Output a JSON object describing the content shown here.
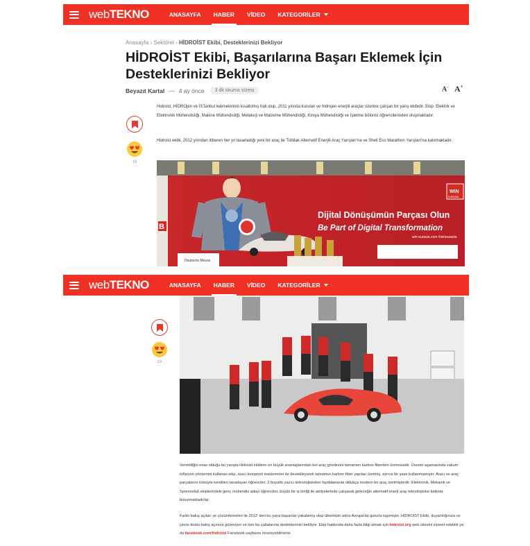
{
  "nav": {
    "logo_a": "web",
    "logo_b": "TEKNO",
    "items": [
      "ANASAYFA",
      "HABER",
      "VİDEO",
      "KATEGORİLER"
    ]
  },
  "breadcrumb": {
    "home": "Anasayfa",
    "sep": "›",
    "category": "Sektörel",
    "current": "HİDROİST Ekibi, Desteklerinizi Bekliyor"
  },
  "article": {
    "title": "HİDROİST Ekibi, Başarılarına Başarı Eklemek İçin Desteklerinizi Bekliyor",
    "author": "Beyazıt Kartal",
    "dash": "—",
    "time": "4 ay önce",
    "read_time": "3 dk okuma süresi",
    "font_small": "A",
    "font_large": "A",
    "reaction_count": "19",
    "paragraphs": [
      "Hidroist, HİDROjen ve İSTanbul kelimelerinin kısaltılmış hali olup, 2011 yılında kurulan ve hidrojen enerjili araçlar üzerine çalışan bir yarış ekibidir. Ekip; Elektrik ve Elektronik Mühendisliği, Makine Mühendisliği, Metalurji ve Malzeme Mühendisliği, Kimya Mühendisliği ve İşletme bölümü öğrencilerinden oluşmaktadır.",
      "Hidroist ekibi, 2012 yılından itibaren her yıl tasarladığı yeni bir araç ile Tübitak Alternatif Enerjili Araç Yarışları'na ve Shell Eco Marathon Yarışları'na katılmaktadır."
    ],
    "banner": {
      "line1": "Dijital Dönüşümün Parçası Olun",
      "line2": "Be Part of Digital Transformation",
      "badge": "WIN",
      "badge_sub": "EURASIA",
      "footer_left": "Deutsche Messe",
      "footer_right": "win-eurasia.com   #wineurasia",
      "left_letter": "B"
    },
    "paragraphs2": [
      "Verimliliğin esas olduğu bu yarışta Hidroist ekibinin en büyük avantajlarından biri araç gövdesini tamamen karbon fiberden üretmesidir. Üresim aşamasında vakum infüzyon yöntemini kullanan ekip, aracı kompozit malzemeler ile destekleyerek tamamen karbon fiber yapılan üretmiş, ayrıca bir şase kullanmamıştır. Aracı ve araç parçalarını tümüyle kendileri tasarlayan öğrenciler, 3 boyutlu yazıcı teknolojisinden faydalanarak oldukça modern bir araç üretmişlerdir. Elektronik, Mekanik ve Sponsorluk ekiplerindeki genç mühendis adayı öğrenciler, büyük bir iş birliği ile atölyelerinde çalışarak geleceğin alternatif enerji araç teknolojisine katkıda bulunmaktadırlar.",
      "Farklı bakış açıları ve çözümlemeleri ile 2012' den bu yana başarılar yakalamış olup ülkemizin adını Avrupa'da gururla taşımıştır. HİDROİST Ekibi, duyarlılığınıza ve çevre dostu bakış açınıza güveniyor ve tüm bu çabalarına desteklerinizi bekliyor. Ekip hakkında daha fazla bilgi almak için"
    ],
    "link1": "hidroist.org",
    "text_mid": "web sitesini ziyaret edebilir ya da",
    "link2": "facebook.com/hidroist",
    "text_end": "Facebook sayfasını inceleyebilirsiniz"
  }
}
